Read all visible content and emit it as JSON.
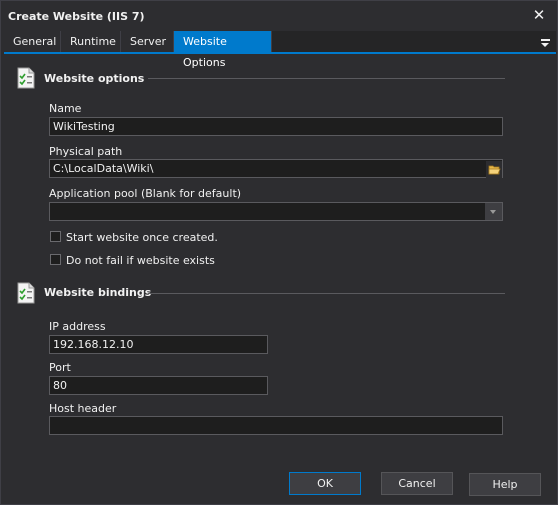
{
  "window": {
    "title": "Create Website (IIS 7)",
    "close_glyph": "✕"
  },
  "tabs": [
    {
      "label": "General"
    },
    {
      "label": "Runtime"
    },
    {
      "label": "Server"
    },
    {
      "label": "Website Options",
      "active": true
    }
  ],
  "website_options": {
    "heading": "Website options",
    "name_label": "Name",
    "name_value": "WikiTesting",
    "path_label": "Physical path",
    "path_value": "C:\\LocalData\\Wiki\\",
    "pool_label": "Application pool (Blank for default)",
    "pool_value": "",
    "start_label": "Start website once created.",
    "start_checked": false,
    "nofail_label": "Do not fail if website exists",
    "nofail_checked": false
  },
  "website_bindings": {
    "heading": "Website bindings",
    "ip_label": "IP address",
    "ip_value": "192.168.12.10",
    "port_label": "Port",
    "port_value": "80",
    "host_label": "Host header",
    "host_value": ""
  },
  "buttons": {
    "ok": "OK",
    "cancel": "Cancel",
    "help": "Help"
  },
  "colors": {
    "accent": "#007acc",
    "background": "#2d2d30",
    "input_background": "#1e1e1e",
    "text": "#f1f1f1"
  },
  "icons": {
    "section": "checklist-document-icon",
    "browse": "folder-icon",
    "menu": "tab-menu-icon"
  }
}
